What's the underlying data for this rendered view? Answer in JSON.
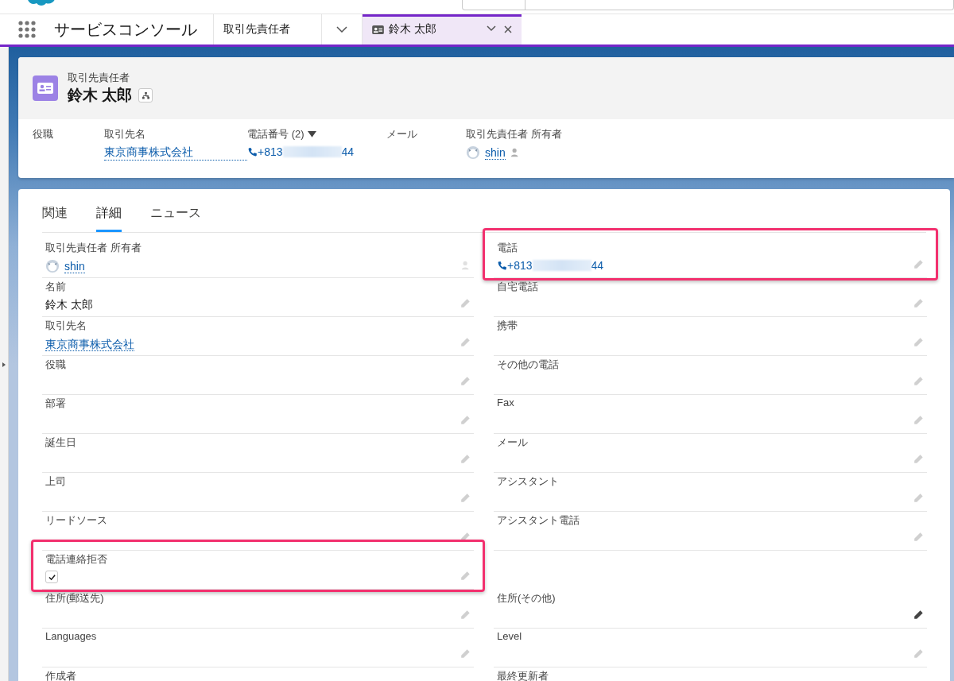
{
  "nav": {
    "app_name": "サービスコンソール",
    "tabs": [
      {
        "label": "取引先責任者",
        "selected": false,
        "kind": "list"
      },
      {
        "label": "鈴木 太郎",
        "selected": true,
        "kind": "record"
      }
    ]
  },
  "header": {
    "object_label": "取引先責任者",
    "title": "鈴木 太郎",
    "highlights": [
      {
        "kind": "text",
        "label": "役職"
      },
      {
        "kind": "link",
        "label": "取引先名",
        "value": "東京商事株式会社"
      },
      {
        "kind": "phone",
        "label": "電話番号",
        "count": "(2)",
        "number_start": "+813",
        "number_end": "44"
      },
      {
        "kind": "text",
        "label": "メール"
      },
      {
        "kind": "owner",
        "label": "取引先責任者 所有者",
        "value": "shin"
      }
    ]
  },
  "tabs": [
    {
      "label": "関連",
      "selected": false
    },
    {
      "label": "詳細",
      "selected": true
    },
    {
      "label": "ニュース",
      "selected": false
    }
  ],
  "rows": [
    {
      "cells": [
        {
          "kind": "owner",
          "label": "取引先責任者 所有者",
          "value": "shin"
        },
        {
          "kind": "phone",
          "label": "電話",
          "number_start": "+813",
          "number_end": "44",
          "highlighted": true
        }
      ]
    },
    {
      "cells": [
        {
          "kind": "text",
          "label": "名前",
          "value": "鈴木 太郎"
        },
        {
          "kind": "text",
          "label": "自宅電話"
        }
      ]
    },
    {
      "cells": [
        {
          "kind": "link",
          "label": "取引先名",
          "value": "東京商事株式会社"
        },
        {
          "kind": "text",
          "label": "携帯"
        }
      ]
    },
    {
      "cells": [
        {
          "kind": "text",
          "label": "役職"
        },
        {
          "kind": "text",
          "label": "その他の電話"
        }
      ]
    },
    {
      "cells": [
        {
          "kind": "text",
          "label": "部署"
        },
        {
          "kind": "text",
          "label": "Fax"
        }
      ]
    },
    {
      "cells": [
        {
          "kind": "text",
          "label": "誕生日"
        },
        {
          "kind": "text",
          "label": "メール"
        }
      ]
    },
    {
      "cells": [
        {
          "kind": "text",
          "label": "上司"
        },
        {
          "kind": "text",
          "label": "アシスタント"
        }
      ]
    },
    {
      "cells": [
        {
          "kind": "text",
          "label": "リードソース"
        },
        {
          "kind": "text",
          "label": "アシスタント電話"
        }
      ]
    },
    {
      "cells": [
        {
          "kind": "checkbox",
          "label": "電話連絡拒否",
          "checked": true,
          "highlighted": true
        }
      ]
    },
    {
      "cells": [
        {
          "kind": "text",
          "label": "住所(郵送先)"
        },
        {
          "kind": "text",
          "label": "住所(その他)",
          "hovered": true
        }
      ]
    },
    {
      "cells": [
        {
          "kind": "text",
          "label": "Languages"
        },
        {
          "kind": "text",
          "label": "Level"
        }
      ]
    },
    {
      "cells": [
        {
          "kind": "text",
          "label": "作成者"
        },
        {
          "kind": "text",
          "label": "最終更新者"
        }
      ]
    }
  ]
}
